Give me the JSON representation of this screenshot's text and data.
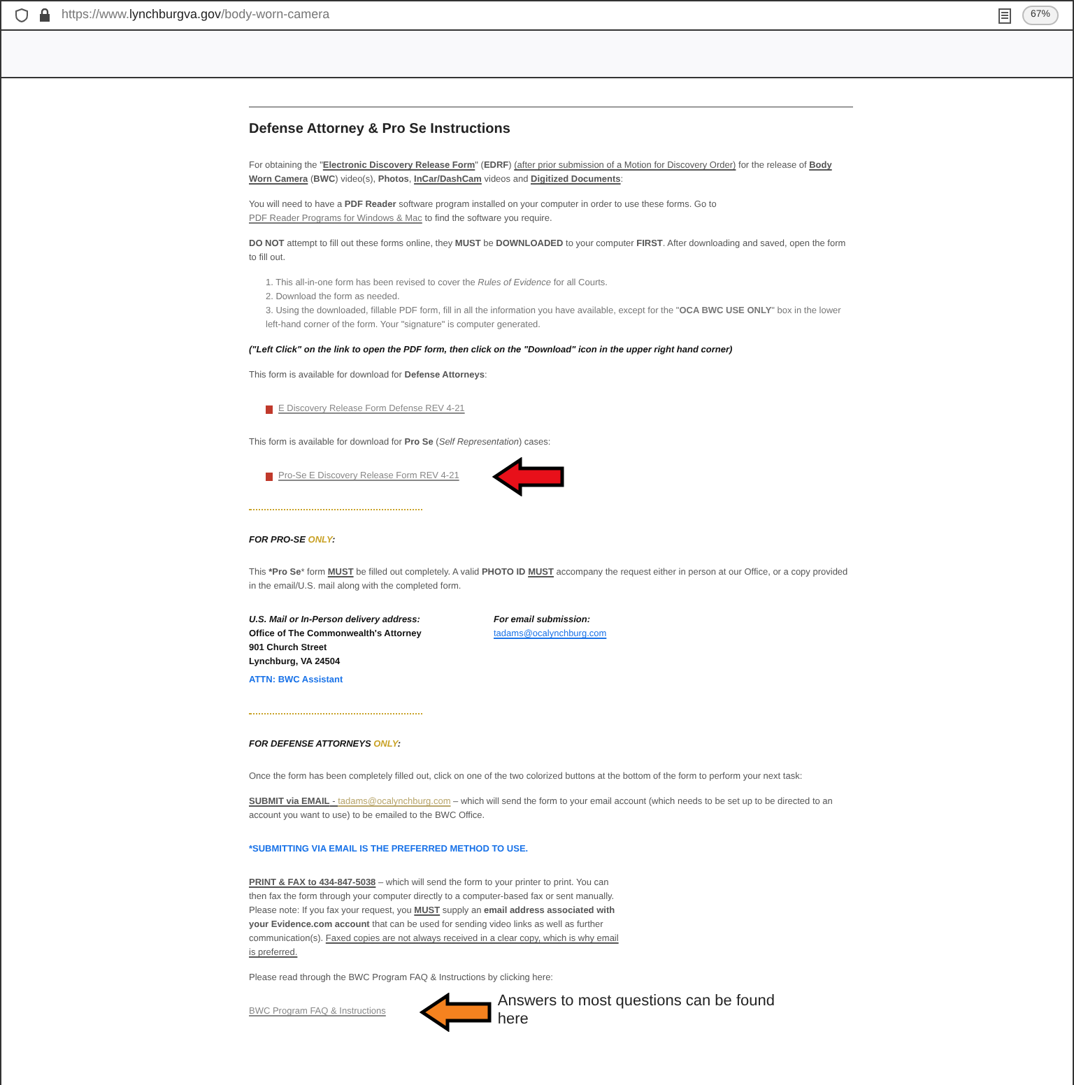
{
  "address_bar": {
    "url_prefix": "https://www.",
    "domain": "lynchburgva.gov",
    "path": "/body-worn-camera",
    "zoom": "67%"
  },
  "heading": "Defense Attorney & Pro Se Instructions",
  "blocks": [
    {
      "kind": "paragraph",
      "segments": [
        {
          "kind": "text",
          "text": "For obtaining the \""
        },
        {
          "kind": "underline",
          "text": "**Electronic Discovery Release Form**"
        },
        {
          "kind": "text",
          "text": "\" (**EDRF**) "
        },
        {
          "kind": "underline",
          "text": "(after prior submission of a Motion for Discovery Order)"
        },
        {
          "kind": "text",
          "text": " for the release of "
        },
        {
          "kind": "underline",
          "text": "**Body Worn Camera**"
        },
        {
          "kind": "text",
          "text": " (**BWC**) video(s), **Photos**, "
        },
        {
          "kind": "underline",
          "text": "**InCar/DashCam**"
        },
        {
          "kind": "text",
          "text": " videos and "
        },
        {
          "kind": "underline",
          "text": "**Digitized Documents**"
        },
        {
          "kind": "text",
          "text": ":"
        }
      ]
    },
    {
      "kind": "paragraph",
      "segments": [
        {
          "kind": "text",
          "text": "You will need to have a **PDF Reader** software program installed on your computer in order to use these forms. Go to "
        },
        {
          "kind": "link",
          "text": "PDF Reader Programs for Windows & Mac"
        },
        {
          "kind": "text",
          "text": " to find the software you require."
        }
      ]
    },
    {
      "kind": "paragraph",
      "segments": [
        {
          "kind": "text",
          "text": "**DO NOT** attempt to fill out these forms online, they **MUST** be **DOWNLOADED** to your computer **FIRST**. After downloading and saved, open the form to fill out."
        }
      ]
    },
    {
      "kind": "list",
      "items": [
        "1. This all-in-one form has been revised to cover the *Rules of Evidence* for all Courts.",
        "2. Download the form as needed.",
        "3. Using the downloaded, fillable PDF form, fill in all the information you have available, except for the \"**OCA BWC USE ONLY**\" box in the lower left-hand corner of the form. Your \"signature\" is computer generated."
      ]
    },
    {
      "kind": "note",
      "text": "(\"Left Click\" on the link to open the PDF form, then click on the \"Download\" icon in the upper right hand corner)"
    },
    {
      "kind": "paragraph",
      "segments": [
        {
          "kind": "text",
          "text": "This form is available for download for **Defense Attorneys**:"
        }
      ]
    },
    {
      "kind": "file_link",
      "text": "E Discovery Release Form Defense REV 4-21",
      "pdf_icon": true
    },
    {
      "kind": "paragraph",
      "segments": [
        {
          "kind": "text",
          "text": "This form is available for download for **Pro Se** (*Self Representation*) cases:"
        }
      ]
    },
    {
      "kind": "file_link",
      "text": "Pro-Se E Discovery Release Form REV 4-21",
      "pdf_icon": true,
      "callout": {
        "color": "#e8101a"
      }
    },
    {
      "kind": "rule"
    },
    {
      "kind": "section",
      "segments": [
        {
          "kind": "text",
          "text": "FOR PRO-SE "
        },
        {
          "kind": "accent",
          "text": "ONLY"
        },
        {
          "kind": "text",
          "text": ":"
        }
      ]
    },
    {
      "kind": "paragraph",
      "segments": [
        {
          "kind": "text",
          "text": "This ***Pro Se*** form "
        },
        {
          "kind": "underline",
          "text": "**MUST**"
        },
        {
          "kind": "text",
          "text": " be filled out completely. A valid **PHOTO ID** "
        },
        {
          "kind": "underline",
          "text": "**MUST**"
        },
        {
          "kind": "text",
          "text": " accompany the request either in person at our Office, or a copy provided in the email/U.S. mail along with the completed form."
        }
      ]
    },
    {
      "kind": "address",
      "label": "U.S. Mail or In-Person delivery address:",
      "lines": [
        "Office of The Commonwealth's Attorney",
        "901 Church Street",
        "Lynchburg, VA 24504"
      ],
      "attn": "ATTN: BWC Assistant",
      "email_label": "For email submission:",
      "email": "tadams@ocalynchburg.com"
    },
    {
      "kind": "rule"
    },
    {
      "kind": "section",
      "segments": [
        {
          "kind": "text",
          "text": "FOR DEFENSE ATTORNEYS "
        },
        {
          "kind": "accent",
          "text": "ONLY"
        },
        {
          "kind": "text",
          "text": ":"
        }
      ]
    },
    {
      "kind": "paragraph",
      "segments": [
        {
          "kind": "text",
          "text": "Once the form has been completely filled out, click on one of the two colorized buttons at the bottom of the form to perform your next task:"
        }
      ]
    },
    {
      "kind": "paragraph",
      "segments": [
        {
          "kind": "underline",
          "text": "**SUBMIT via EMAIL** - "
        },
        {
          "kind": "accent_link",
          "text": "tadams@ocalynchburg.com"
        },
        {
          "kind": "text",
          "text": " – which will send the form to your email account (which needs to be set up to be directed to an account you want to use) to be emailed to the BWC Office."
        }
      ]
    },
    {
      "kind": "blue_note",
      "text": "*SUBMITTING VIA EMAIL IS THE PREFERRED METHOD TO USE."
    },
    {
      "kind": "narrow_paragraph",
      "segments": [
        {
          "kind": "underline",
          "text": "**PRINT & FAX to 434-847-5038**"
        },
        {
          "kind": "text",
          "text": " – which will send the form to your printer to print. You can then fax the form through your computer directly to a computer-based fax or sent manually. Please note: If you fax your request, you "
        },
        {
          "kind": "underline",
          "text": "**MUST**"
        },
        {
          "kind": "text",
          "text": " supply an **email address associated with your Evidence.com account** that can be used for sending video links as well as further communication(s). "
        },
        {
          "kind": "underline",
          "text": "Faxed copies are not always received in a clear copy, which is why email is preferred."
        }
      ]
    },
    {
      "kind": "paragraph",
      "segments": [
        {
          "kind": "text",
          "text": "Please read through the BWC Program FAQ & Instructions by clicking here:"
        }
      ]
    },
    {
      "kind": "file_link",
      "text": "BWC Program FAQ & Instructions",
      "pdf_icon": false,
      "callout": {
        "color": "#f5821f",
        "caption": "Answers to most questions can be found here"
      }
    }
  ]
}
